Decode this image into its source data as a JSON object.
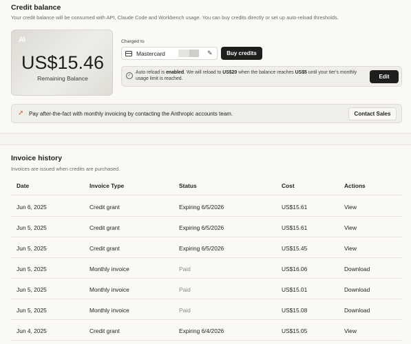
{
  "credit": {
    "title": "Credit balance",
    "subtitle": "Your credit balance will be consumed with API, Claude Code and Workbench usage. You can buy credits directly or set up auto-reload thresholds.",
    "logo": "A\\",
    "balance": "US$15.46",
    "balance_label": "Remaining Balance",
    "charged_label": "Charged to",
    "card_name": "Mastercard",
    "buy_label": "Buy credits",
    "autoreload_prefix": "Auto reload is ",
    "autoreload_enabled": "enabled",
    "autoreload_mid": ". We will reload to ",
    "autoreload_amount": "US$20",
    "autoreload_mid2": " when the balance reaches ",
    "autoreload_threshold": "US$5",
    "autoreload_suffix": " until your tier's monthly usage limit is reached.",
    "edit_label": "Edit",
    "banner_text": "Pay after-the-fact with monthly invoicing by contacting the Anthropic accounts team.",
    "contact_label": "Contact Sales"
  },
  "invoices": {
    "title": "Invoice history",
    "subtitle": "Invoices are issued when credits are purchased.",
    "columns": [
      "Date",
      "Invoice Type",
      "Status",
      "Cost",
      "Actions"
    ],
    "rows": [
      {
        "date": "Jun 6, 2025",
        "type": "Credit grant",
        "status": "Expiring 6/5/2026",
        "cost": "US$15.61",
        "action": "View"
      },
      {
        "date": "Jun 5, 2025",
        "type": "Credit grant",
        "status": "Expiring 6/5/2026",
        "cost": "US$15.61",
        "action": "View"
      },
      {
        "date": "Jun 5, 2025",
        "type": "Credit grant",
        "status": "Expiring 6/5/2026",
        "cost": "US$15.45",
        "action": "View"
      },
      {
        "date": "Jun 5, 2025",
        "type": "Monthly invoice",
        "status": "Paid",
        "cost": "US$16.06",
        "action": "Download"
      },
      {
        "date": "Jun 5, 2025",
        "type": "Monthly invoice",
        "status": "Paid",
        "cost": "US$15.01",
        "action": "Download"
      },
      {
        "date": "Jun 5, 2025",
        "type": "Monthly invoice",
        "status": "Paid",
        "cost": "US$15.08",
        "action": "Download"
      },
      {
        "date": "Jun 4, 2025",
        "type": "Credit grant",
        "status": "Expiring 6/4/2026",
        "cost": "US$15.05",
        "action": "View"
      }
    ]
  },
  "icons": {
    "logo": "anthropic-logo",
    "card": "credit-card-icon",
    "edit": "pencil-icon",
    "check": "check-circle-icon",
    "banner": "rocket-icon"
  },
  "colors": {
    "background": "#faf9f5",
    "primary_button": "#1f1e1c",
    "accent": "#c8624a"
  }
}
